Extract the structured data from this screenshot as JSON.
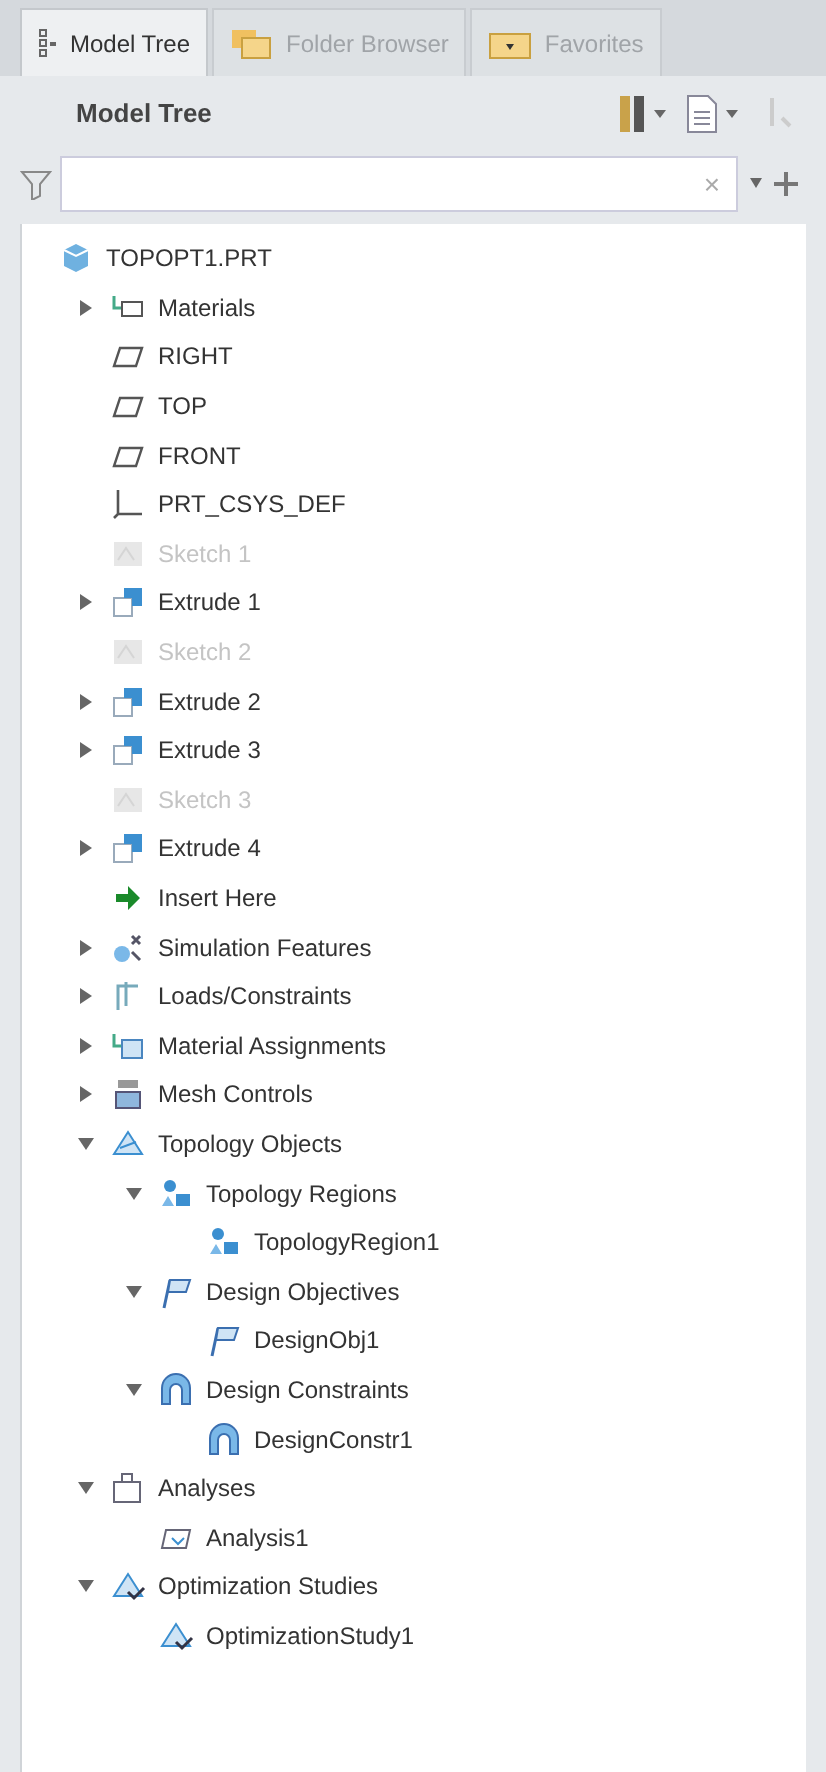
{
  "tabs": [
    {
      "label": "Model Tree",
      "selected": true,
      "kind": "tree"
    },
    {
      "label": "Folder Browser",
      "selected": false,
      "kind": "folder"
    },
    {
      "label": "Favorites",
      "selected": false,
      "kind": "favorites"
    }
  ],
  "toolbar": {
    "title": "Model Tree"
  },
  "filter": {
    "clear": "×"
  },
  "tree": [
    {
      "label": "TOPOPT1.PRT",
      "kind": "part",
      "suppressed": false,
      "children": [
        {
          "label": "Materials",
          "kind": "materials",
          "expanded": false,
          "suppressed": false
        },
        {
          "label": "RIGHT",
          "kind": "plane",
          "suppressed": false
        },
        {
          "label": "TOP",
          "kind": "plane",
          "suppressed": false
        },
        {
          "label": "FRONT",
          "kind": "plane",
          "suppressed": false
        },
        {
          "label": "PRT_CSYS_DEF",
          "kind": "csys",
          "suppressed": false
        },
        {
          "label": "Sketch 1",
          "kind": "sketch",
          "suppressed": true
        },
        {
          "label": "Extrude 1",
          "kind": "extrude",
          "expanded": false,
          "suppressed": false
        },
        {
          "label": "Sketch 2",
          "kind": "sketch",
          "suppressed": true
        },
        {
          "label": "Extrude 2",
          "kind": "extrude",
          "expanded": false,
          "suppressed": false
        },
        {
          "label": "Extrude 3",
          "kind": "extrude",
          "expanded": false,
          "suppressed": false
        },
        {
          "label": "Sketch 3",
          "kind": "sketch",
          "suppressed": true
        },
        {
          "label": "Extrude 4",
          "kind": "extrude",
          "expanded": false,
          "suppressed": false
        },
        {
          "label": "Insert Here",
          "kind": "insert",
          "suppressed": false
        },
        {
          "label": "Simulation Features",
          "kind": "simulation",
          "expanded": false,
          "suppressed": false
        },
        {
          "label": "Loads/Constraints",
          "kind": "loads",
          "expanded": false,
          "suppressed": false
        },
        {
          "label": "Material Assignments",
          "kind": "assign",
          "expanded": false,
          "suppressed": false
        },
        {
          "label": "Mesh Controls",
          "kind": "mesh",
          "expanded": false,
          "suppressed": false
        },
        {
          "label": "Topology Objects",
          "kind": "topology",
          "expanded": true,
          "suppressed": false,
          "children": [
            {
              "label": "Topology Regions",
              "kind": "region",
              "expanded": true,
              "suppressed": false,
              "children": [
                {
                  "label": "TopologyRegion1",
                  "kind": "region",
                  "suppressed": false
                }
              ]
            },
            {
              "label": "Design Objectives",
              "kind": "objective",
              "expanded": true,
              "suppressed": false,
              "children": [
                {
                  "label": "DesignObj1",
                  "kind": "objective",
                  "suppressed": false
                }
              ]
            },
            {
              "label": "Design Constraints",
              "kind": "constraint",
              "expanded": true,
              "suppressed": false,
              "children": [
                {
                  "label": "DesignConstr1",
                  "kind": "constraint",
                  "suppressed": false
                }
              ]
            }
          ]
        },
        {
          "label": "Analyses",
          "kind": "analysis",
          "expanded": true,
          "suppressed": false,
          "children": [
            {
              "label": "Analysis1",
              "kind": "analysis-item",
              "suppressed": false
            }
          ]
        },
        {
          "label": "Optimization Studies",
          "kind": "study",
          "expanded": true,
          "suppressed": false,
          "children": [
            {
              "label": "OptimizationStudy1",
              "kind": "study",
              "suppressed": false
            }
          ]
        }
      ]
    }
  ]
}
